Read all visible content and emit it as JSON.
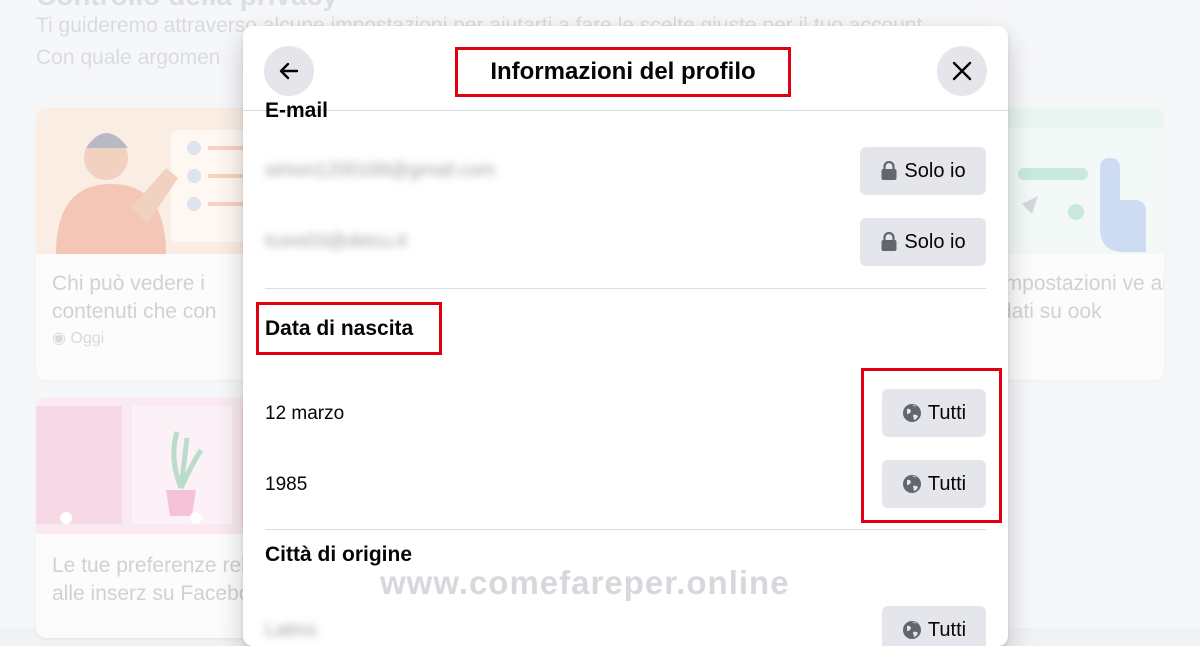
{
  "background": {
    "heading": "Controllo della privacy",
    "intro_line1": "Ti guideremo attraverso alcune impostazioni per aiutarti a fare le scelte giuste per il tuo account.",
    "intro_line2": "Con quale argomen",
    "cards": [
      {
        "title": "Chi può vedere i contenuti che con",
        "sub": "Oggi"
      },
      {
        "title": "Le tue preferenze relative alle inserz su Facebook"
      },
      {
        "title": "impostazioni ve ai dati su ook"
      }
    ]
  },
  "modal": {
    "title": "Informazioni del profilo",
    "sections": {
      "email": {
        "title": "E-mail",
        "rows": [
          {
            "value": "simon1200168@gmail.com",
            "audience": "Solo io"
          },
          {
            "value": "lcore03@delcu.it",
            "audience": "Solo io"
          }
        ]
      },
      "birthdate": {
        "title": "Data di nascita",
        "rows": [
          {
            "value": "12 marzo",
            "audience": "Tutti"
          },
          {
            "value": "1985",
            "audience": "Tutti"
          }
        ]
      },
      "hometown": {
        "title": "Città di origine",
        "rows": [
          {
            "value": "Latino",
            "audience": "Tutti"
          }
        ]
      }
    }
  },
  "watermark": "www.comefareper.online",
  "icons": {
    "back": "arrow-left-icon",
    "close": "close-icon",
    "lock": "lock-icon",
    "globe": "globe-icon"
  },
  "colors": {
    "highlight": "#e1000f",
    "button_bg": "#e4e6eb",
    "text": "#050505"
  }
}
